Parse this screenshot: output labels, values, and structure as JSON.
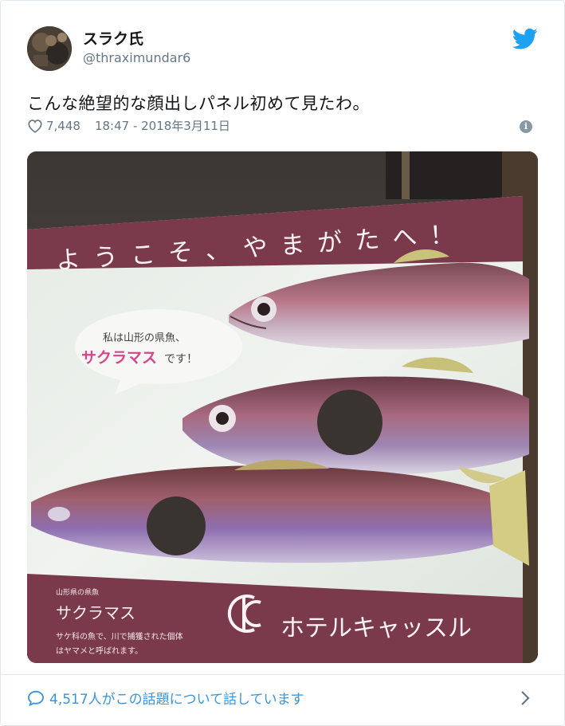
{
  "tweet": {
    "display_name": "スラク氏",
    "handle": "@thraximundar6",
    "text": "こんな絶望的な顔出しパネル初めて見たわ。",
    "likes": "7,448",
    "timestamp": "18:47 - 2018年3月11日",
    "conversation": "4,517人がこの話題について話しています"
  },
  "photo": {
    "banner": "ようこそ、やまがたへ！",
    "speech_line1": "私は山形の県魚、",
    "speech_fish": "サクラマス",
    "speech_end": "です！",
    "label_small": "山形県の県魚",
    "label_fish": "サクラマス",
    "desc_line1": "サケ科の魚で、川で捕獲された個体",
    "desc_line2": "はヤマメと呼ばれます。",
    "hotel_name": "ホテルキャッスル"
  },
  "colors": {
    "twitter_blue": "#1da1f2",
    "link_blue": "#3b94d9",
    "secondary_gray": "#657786",
    "panel_maroon": "#7a3a4c",
    "speech_pink": "#d6458a"
  },
  "icons": {
    "brand": "twitter-bird-icon",
    "like": "heart-icon",
    "info": "info-icon",
    "reply": "speech-bubble-icon",
    "next": "chevron-right-icon"
  }
}
